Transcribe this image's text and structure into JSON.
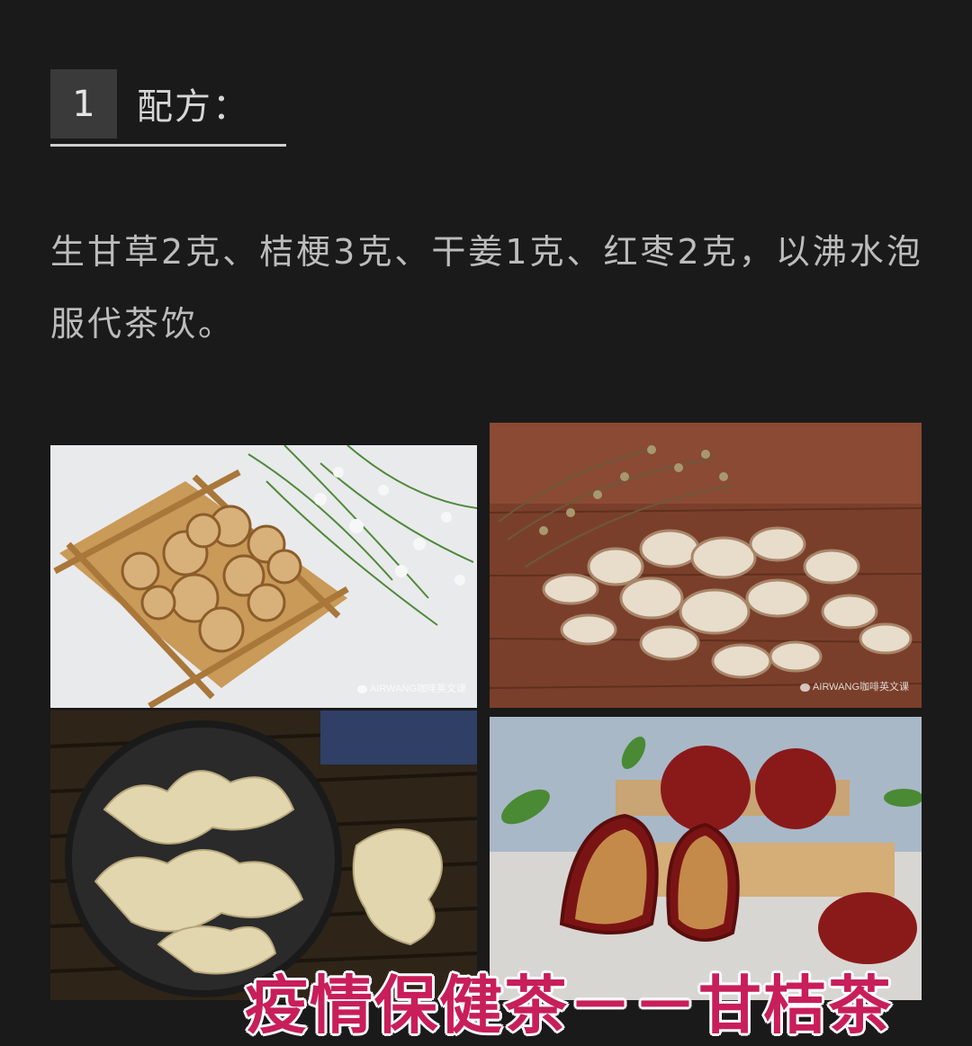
{
  "section": {
    "number": "1",
    "heading": "配方："
  },
  "recipe_text": "生甘草2克、桔梗3克、干姜1克、红枣2克，以沸水泡服代茶饮。",
  "photos": {
    "licorice": {
      "icon": "licorice-root-photo",
      "watermark": "AIRWANG咖啡英文课"
    },
    "platycodon": {
      "icon": "platycodon-root-photo",
      "watermark": "AIRWANG咖啡英文课"
    },
    "ginger": {
      "icon": "dried-ginger-photo"
    },
    "dates": {
      "icon": "red-dates-photo"
    }
  },
  "caption": "疫情保健茶－－甘桔茶",
  "colors": {
    "background": "#1a1a1a",
    "caption": "#c81e5a",
    "caption_outline": "#ffffff"
  }
}
